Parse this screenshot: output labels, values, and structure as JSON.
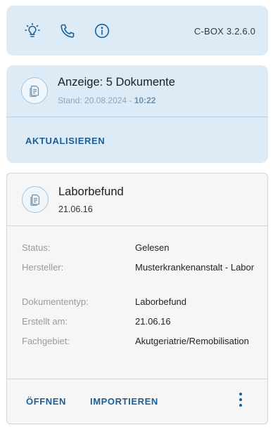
{
  "toolbar": {
    "icons": [
      "lightbulb-icon",
      "phone-icon",
      "info-icon"
    ],
    "version": "C-BOX 3.2.6.0"
  },
  "summary": {
    "title": "Anzeige: 5 Dokumente",
    "stand_prefix": "Stand: 20.08.2024 - ",
    "stand_time": "10:22",
    "refresh_label": "AKTUALISIEREN"
  },
  "document": {
    "title": "Laborbefund",
    "date": "21.06.16",
    "fields": [
      {
        "label": "Status:",
        "value": "Gelesen"
      },
      {
        "label": "Hersteller:",
        "value": "Musterkrankenanstalt - Labor"
      },
      {
        "label": "Dokumententyp:",
        "value": "Laborbefund"
      },
      {
        "label": "Erstellt am:",
        "value": "21.06.16"
      },
      {
        "label": "Fachgebiet:",
        "value": "Akutgeriatrie/Remobilisation"
      }
    ],
    "actions": {
      "open_label": "ÖFFNEN",
      "import_label": "IMPORTIEREN"
    }
  },
  "colors": {
    "accent": "#1c5f96",
    "panel": "#dcebf6",
    "card": "#f6f6f6"
  }
}
